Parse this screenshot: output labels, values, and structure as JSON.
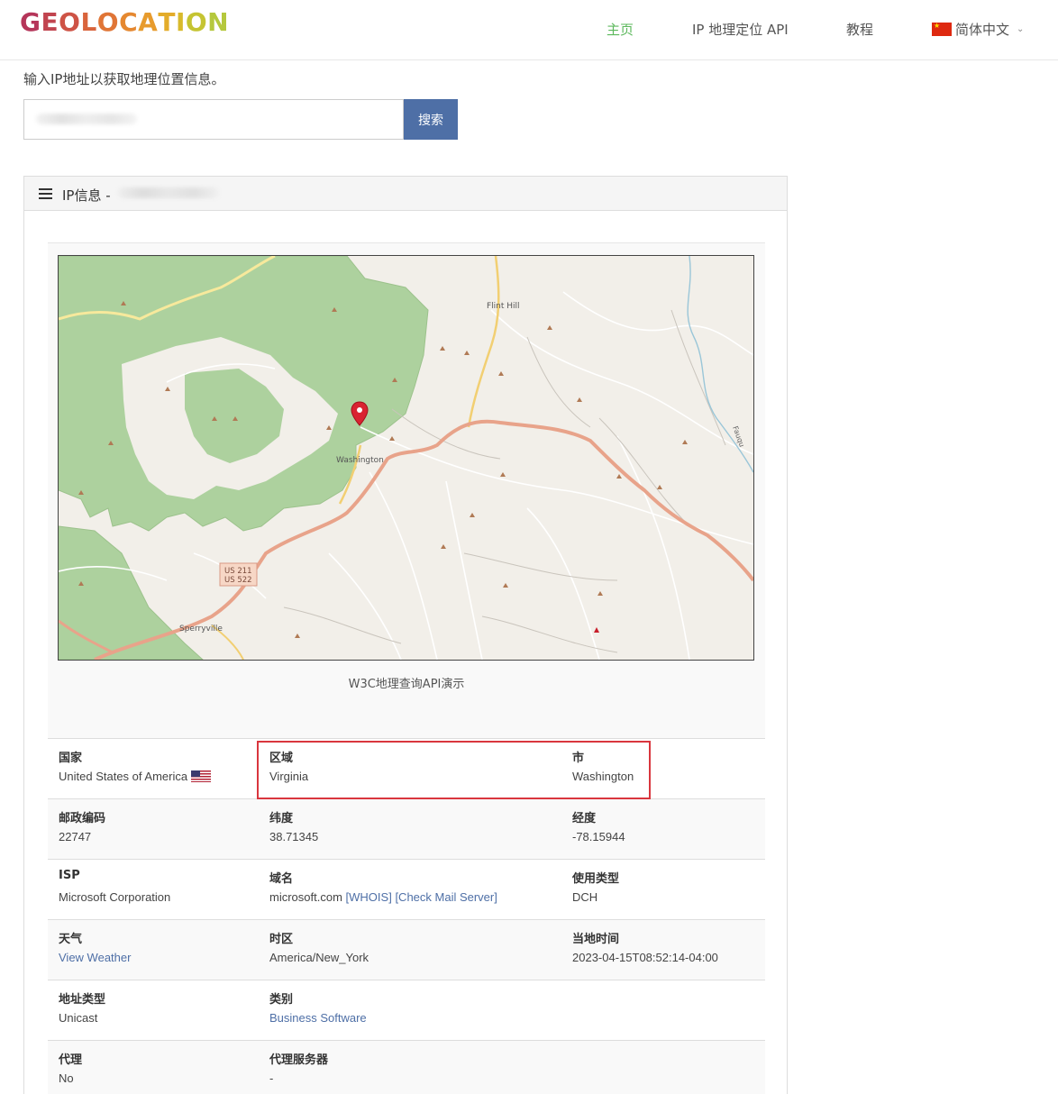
{
  "header": {
    "logo_letters": [
      "G",
      "E",
      "O",
      "L",
      "O",
      "C",
      "A",
      "T",
      "I",
      "O",
      "N"
    ],
    "logo_colors": [
      "#b5365a",
      "#c1444f",
      "#ce5346",
      "#d9643c",
      "#e07536",
      "#e58830",
      "#e79b2d",
      "#e3ac2a",
      "#d8ba2b",
      "#c5c432",
      "#b5c83d"
    ],
    "nav": {
      "home": "主页",
      "api": "IP 地理定位 API",
      "tutorial": "教程",
      "language": "简体中文"
    },
    "active_color": "#5cb85c"
  },
  "search": {
    "prompt": "输入IP地址以获取地理位置信息。",
    "button_label": "搜索",
    "button_color": "#4e6fa6"
  },
  "panel": {
    "title": "IP信息 -",
    "map_caption": "W3C地理查询API演示",
    "map_labels": {
      "flint_hill": "Flint Hill",
      "washington": "Washington",
      "sperryville": "Sperryville",
      "fauquier": "Fauqu",
      "shield_1": "US 211",
      "shield_2": "US 522"
    }
  },
  "info": {
    "rows": [
      {
        "c1_label": "国家",
        "c1_value": "United States of America",
        "c2_label": "区域",
        "c2_value": "Virginia",
        "c3_label": "市",
        "c3_value": "Washington"
      },
      {
        "c1_label": "邮政编码",
        "c1_value": "22747",
        "c2_label": "纬度",
        "c2_value": "38.71345",
        "c3_label": "经度",
        "c3_value": "-78.15944"
      },
      {
        "c1_label": "ISP",
        "c1_value": "Microsoft Corporation",
        "c2_label": "域名",
        "c2_value": "microsoft.com",
        "c2_whois": "[WHOIS]",
        "c2_mail": "[Check Mail Server]",
        "c3_label": "使用类型",
        "c3_value": "DCH"
      },
      {
        "c1_label": "天气",
        "c1_value": "View Weather",
        "c2_label": "时区",
        "c2_value": "America/New_York",
        "c3_label": "当地时间",
        "c3_value": "2023-04-15T08:52:14-04:00"
      },
      {
        "c1_label": "地址类型",
        "c1_value": "Unicast",
        "c2_label": "类别",
        "c2_value": "Business Software"
      },
      {
        "c1_label": "代理",
        "c1_value": "No",
        "c2_label": "代理服务器",
        "c2_value": "-"
      }
    ]
  },
  "colors": {
    "link": "#4e6fa6",
    "highlight_border": "#d9363e",
    "map_forest": "#add19e",
    "map_road_primary": "#e8a38a"
  }
}
